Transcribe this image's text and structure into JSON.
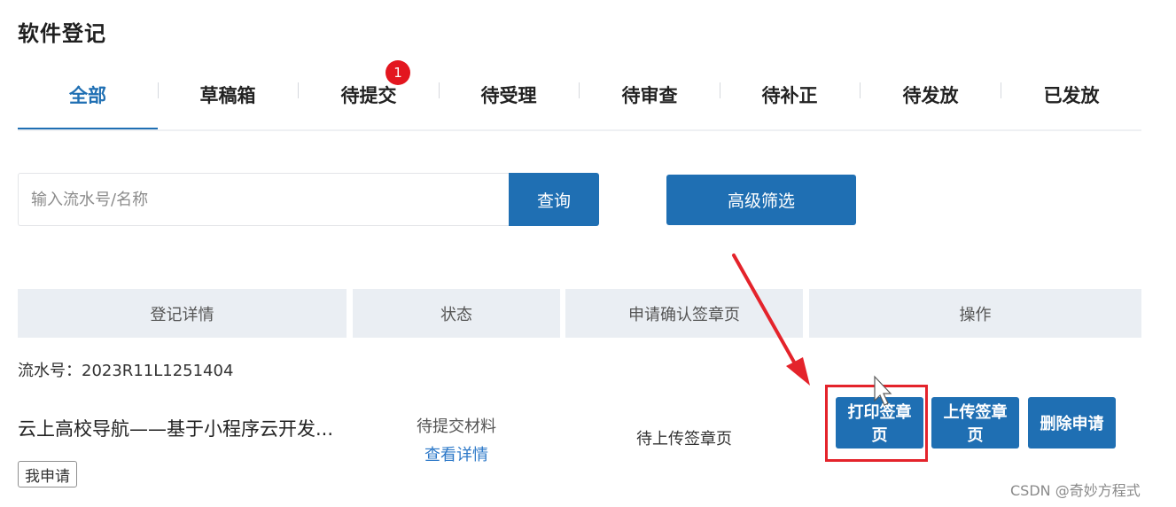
{
  "page": {
    "title": "软件登记"
  },
  "tabs": [
    {
      "label": "全部",
      "active": true
    },
    {
      "label": "草稿箱"
    },
    {
      "label": "待提交",
      "badge": "1"
    },
    {
      "label": "待受理"
    },
    {
      "label": "待审查"
    },
    {
      "label": "待补正"
    },
    {
      "label": "待发放"
    },
    {
      "label": "已发放"
    }
  ],
  "search": {
    "placeholder": "输入流水号/名称",
    "value": "",
    "button_label": "查询"
  },
  "filter": {
    "button_label": "高级筛选"
  },
  "table": {
    "headers": [
      "登记详情",
      "状态",
      "申请确认签章页",
      "操作"
    ],
    "rows": [
      {
        "serial_label": "流水号：2023R11L1251404",
        "title": "云上高校导航——基于小程序云开发...",
        "tag": "我申请",
        "status": "待提交材料",
        "detail_link": "查看详情",
        "sign_status": "待上传签章页",
        "actions": [
          "打印签章页",
          "上传签章页",
          "删除申请"
        ]
      }
    ]
  },
  "colors": {
    "primary": "#1f6fb3",
    "badge": "#e3161f",
    "annotation": "#e4232b",
    "header_bg": "#eaeef3"
  },
  "watermark": "CSDN @奇妙方程式"
}
